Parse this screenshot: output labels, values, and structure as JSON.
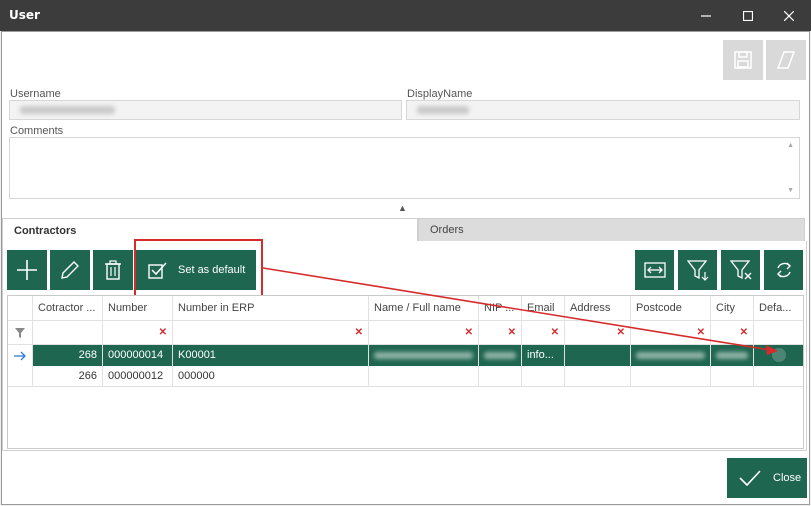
{
  "window": {
    "title": "User"
  },
  "form": {
    "username_label": "Username",
    "displayname_label": "DisplayName",
    "comments_label": "Comments"
  },
  "tabs": [
    {
      "label": "Contractors",
      "active": true
    },
    {
      "label": "Orders",
      "active": false
    }
  ],
  "toolbar": {
    "set_default_label": "Set as default"
  },
  "grid": {
    "columns": [
      "Cotractor ...",
      "Number",
      "Number in ERP",
      "Name / Full name",
      "NIP ...",
      "Email",
      "Address",
      "Postcode",
      "City",
      "Defa..."
    ],
    "rows": [
      {
        "contractor": "268",
        "number": "000000014",
        "erp": "K00001",
        "email": "info...",
        "selected": true
      },
      {
        "contractor": "266",
        "number": "000000012",
        "erp": "000000",
        "email": "",
        "selected": false
      }
    ]
  },
  "footer": {
    "close_label": "Close"
  },
  "colors": {
    "accent": "#1f6650",
    "highlight": "#d52b2b",
    "titlebar": "#3c3c3c"
  }
}
